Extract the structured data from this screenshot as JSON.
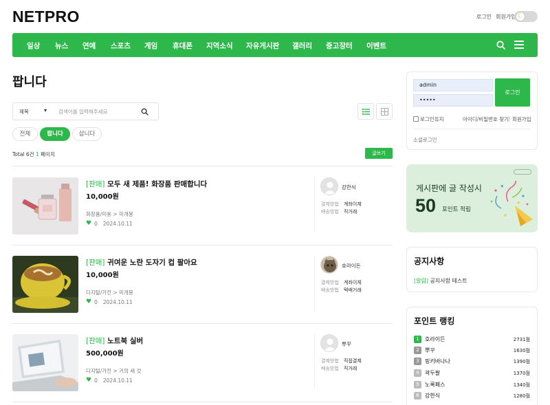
{
  "header": {
    "logo": "NETPRO",
    "login": "로그인",
    "signup": "회원가입",
    "theme_icon": "moon-icon"
  },
  "nav": {
    "items": [
      "일상",
      "뉴스",
      "연예",
      "스포츠",
      "게임",
      "휴대폰",
      "지역소식",
      "자유게시판",
      "갤러리",
      "중고장터",
      "이벤트"
    ]
  },
  "main": {
    "title": "팝니다",
    "search": {
      "select_value": "제목",
      "placeholder": "검색어를 입력해주세요"
    },
    "filters": [
      "전체",
      "팝니다",
      "삽니다"
    ],
    "active_filter": "팝니다",
    "total_prefix": "Total 6건",
    "total_page": "1",
    "total_suffix": "페이지",
    "write_label": "글쓰기",
    "posts": [
      {
        "tag": "[판매]",
        "title": "모두 새 제품! 화장품 판매합니다",
        "price": "10,000원",
        "category": "화장품/미용",
        "condition": "미개봉",
        "likes": "0",
        "date": "2024.10.11",
        "seller": "강한식",
        "pay_label": "결제방법",
        "pay": "계좌이체",
        "ship_label": "배송방법",
        "ship": "직거래"
      },
      {
        "tag": "[판매]",
        "title": "귀여운 노란 도자기 컵 팔아요",
        "price": "10,000원",
        "category": "디지털/가전",
        "condition": "미개봉",
        "likes": "0",
        "date": "2024.10.11",
        "seller": "호라이든",
        "pay_label": "결제방법",
        "pay": "계좌이체",
        "ship_label": "배송방법",
        "ship": "택배거래"
      },
      {
        "tag": "[판매]",
        "title": "노트북 실버",
        "price": "500,000원",
        "category": "디지털/가전",
        "condition": "거의 새 것",
        "likes": "0",
        "date": "2024.10.11",
        "seller": "뿌꾸",
        "pay_label": "결제방법",
        "pay": "직접결제",
        "ship_label": "배송방법",
        "ship": "직거래"
      }
    ]
  },
  "sidebar": {
    "login": {
      "id_value": "admin",
      "pw_value": "•••••",
      "button": "로그인",
      "keep": "로그인유지",
      "find": "아이디/비밀번호 찾기",
      "signup": "회원가입",
      "social": "소셜로그인"
    },
    "banner": {
      "line1": "게시판에 글 작성시",
      "big": "50",
      "line2": "포인트 적립"
    },
    "notice": {
      "title": "공지사항",
      "tag": "[알림]",
      "text": "공지사항 테스트"
    },
    "ranking": {
      "title": "포인트 랭킹",
      "rows": [
        {
          "rank": "1",
          "name": "호라이든",
          "points": "2731점"
        },
        {
          "rank": "2",
          "name": "뿌꾸",
          "points": "1630점"
        },
        {
          "rank": "3",
          "name": "핑키바나나",
          "points": "1390점"
        },
        {
          "rank": "4",
          "name": "곽두팔",
          "points": "1370점"
        },
        {
          "rank": "5",
          "name": "노록페스",
          "points": "1340점"
        },
        {
          "rank": "6",
          "name": "강한식",
          "points": "1280점"
        }
      ]
    }
  },
  "colors": {
    "accent": "#2eb84b",
    "banner_bg": "#dcefdc"
  }
}
